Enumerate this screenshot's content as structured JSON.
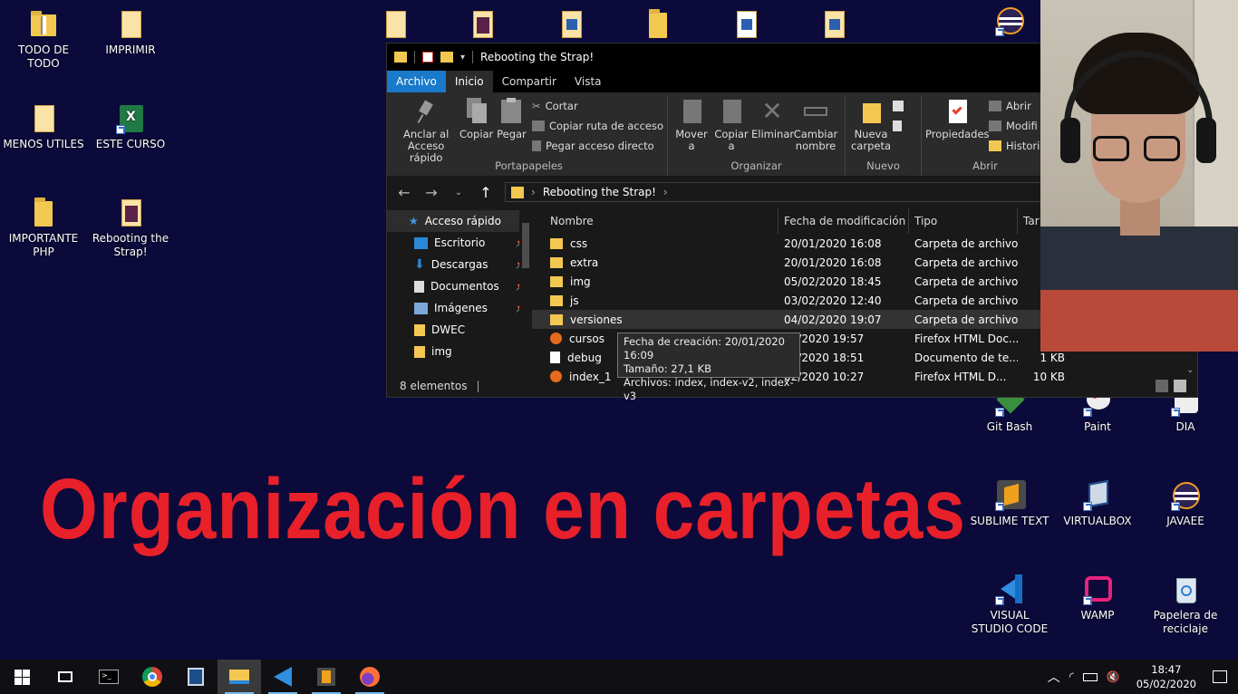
{
  "desktop": {
    "left_icons": [
      {
        "label": "TODO DE TODO",
        "icon": "folder-zip-icon"
      },
      {
        "label": "IMPRIMIR",
        "icon": "folder-docs-icon"
      },
      {
        "label": "MENOS UTILES",
        "icon": "folder-docs-icon"
      },
      {
        "label": "ESTE CURSO",
        "icon": "excel-icon"
      },
      {
        "label": "IMPORTANTE PHP",
        "icon": "folder-icon"
      },
      {
        "label": "Rebooting the Strap!",
        "icon": "folder-docs-icon"
      }
    ],
    "right_icons": [
      {
        "label": "Git Bash",
        "icon": "git-bash-icon"
      },
      {
        "label": "Paint",
        "icon": "paint-icon"
      },
      {
        "label": "DIA",
        "icon": "dia-icon"
      },
      {
        "label": "SUBLIME TEXT",
        "icon": "sublime-text-icon"
      },
      {
        "label": "VIRTUALBOX",
        "icon": "virtualbox-icon"
      },
      {
        "label": "JAVAEE",
        "icon": "eclipse-icon"
      },
      {
        "label": "VISUAL STUDIO CODE",
        "icon": "vscode-icon"
      },
      {
        "label": "WAMP",
        "icon": "wamp-icon"
      },
      {
        "label": "Papelera de reciclaje",
        "icon": "recycle-bin-icon"
      }
    ]
  },
  "explorer": {
    "title": "Rebooting the Strap!",
    "tabs": {
      "file": "Archivo",
      "home": "Inicio",
      "share": "Compartir",
      "view": "Vista"
    },
    "ribbon": {
      "pin": "Anclar al Acceso rápido",
      "copy": "Copiar",
      "paste": "Pegar",
      "cut": "Cortar",
      "copy_path": "Copiar ruta de acceso",
      "paste_shortcut": "Pegar acceso directo",
      "clipboard_group": "Portapapeles",
      "move_to": "Mover a",
      "copy_to": "Copiar a",
      "delete": "Eliminar",
      "rename": "Cambiar nombre",
      "organize_group": "Organizar",
      "new_folder": "Nueva carpeta",
      "new_group": "Nuevo",
      "properties": "Propiedades",
      "open": "Abrir",
      "modify": "Modifi",
      "history": "Historia",
      "open_group": "Abrir"
    },
    "address": "Rebooting the Strap!",
    "nav": [
      {
        "label": "Acceso rápido",
        "pinned": false
      },
      {
        "label": "Escritorio",
        "pinned": true
      },
      {
        "label": "Descargas",
        "pinned": true
      },
      {
        "label": "Documentos",
        "pinned": true
      },
      {
        "label": "Imágenes",
        "pinned": true
      },
      {
        "label": "DWEC",
        "pinned": false
      },
      {
        "label": "img",
        "pinned": false
      }
    ],
    "columns": {
      "name": "Nombre",
      "modified": "Fecha de modificación",
      "type": "Tipo",
      "size": "Tar"
    },
    "files": [
      {
        "name": "css",
        "modified": "20/01/2020 16:08",
        "type": "Carpeta de archivos",
        "size": "",
        "kind": "folder"
      },
      {
        "name": "extra",
        "modified": "20/01/2020 16:08",
        "type": "Carpeta de archivos",
        "size": "",
        "kind": "folder"
      },
      {
        "name": "img",
        "modified": "05/02/2020 18:45",
        "type": "Carpeta de archivos",
        "size": "",
        "kind": "folder"
      },
      {
        "name": "js",
        "modified": "03/02/2020 12:40",
        "type": "Carpeta de archivos",
        "size": "",
        "kind": "folder"
      },
      {
        "name": "versiones",
        "modified": "04/02/2020 19:07",
        "type": "Carpeta de archivos",
        "size": "",
        "kind": "folder"
      },
      {
        "name": "cursos",
        "modified": "02/2020 19:57",
        "type": "Firefox HTML Doc...",
        "size": "",
        "kind": "firefox"
      },
      {
        "name": "debug",
        "modified": "01/2020 18:51",
        "type": "Documento de te...",
        "size": "1 KB",
        "kind": "doc"
      },
      {
        "name": "index_1",
        "modified": "02/2020 10:27",
        "type": "Firefox HTML D...",
        "size": "10 KB",
        "kind": "firefox"
      }
    ],
    "tooltip": {
      "created": "Fecha de creación: 20/01/2020 16:09",
      "size": "Tamaño: 27,1 KB",
      "files": "Archivos: index, index-v2, index-v3"
    },
    "status": "8 elementos"
  },
  "overlay_title": "Organización en carpetas",
  "taskbar": {
    "apps": [
      "start-icon",
      "task-view-icon",
      "terminal-icon",
      "chrome-icon",
      "virtualbox-icon",
      "file-explorer-icon",
      "vscode-icon",
      "sublime-text-icon",
      "firefox-icon"
    ],
    "time": "18:47",
    "date": "05/02/2020"
  }
}
